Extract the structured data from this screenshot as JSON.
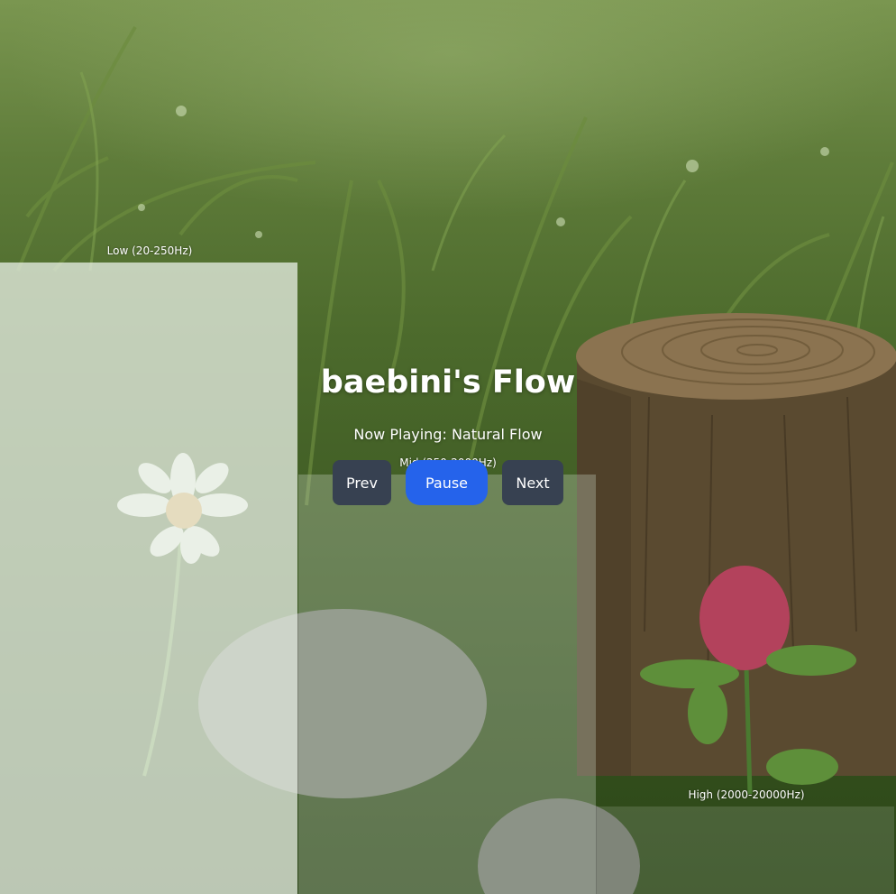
{
  "player": {
    "title": "baebini's Flow",
    "now_playing": "Now Playing: Natural Flow"
  },
  "controls": {
    "prev_label": "Prev",
    "pause_label": "Pause",
    "next_label": "Next"
  },
  "equalizer": {
    "low_label": "Low (20-250Hz)",
    "mid_label": "Mid (250-2000Hz)",
    "high_label": "High (2000-20000Hz)"
  },
  "colors": {
    "button": "#374151",
    "button_active": "#2563eb",
    "text": "#ffffff"
  }
}
